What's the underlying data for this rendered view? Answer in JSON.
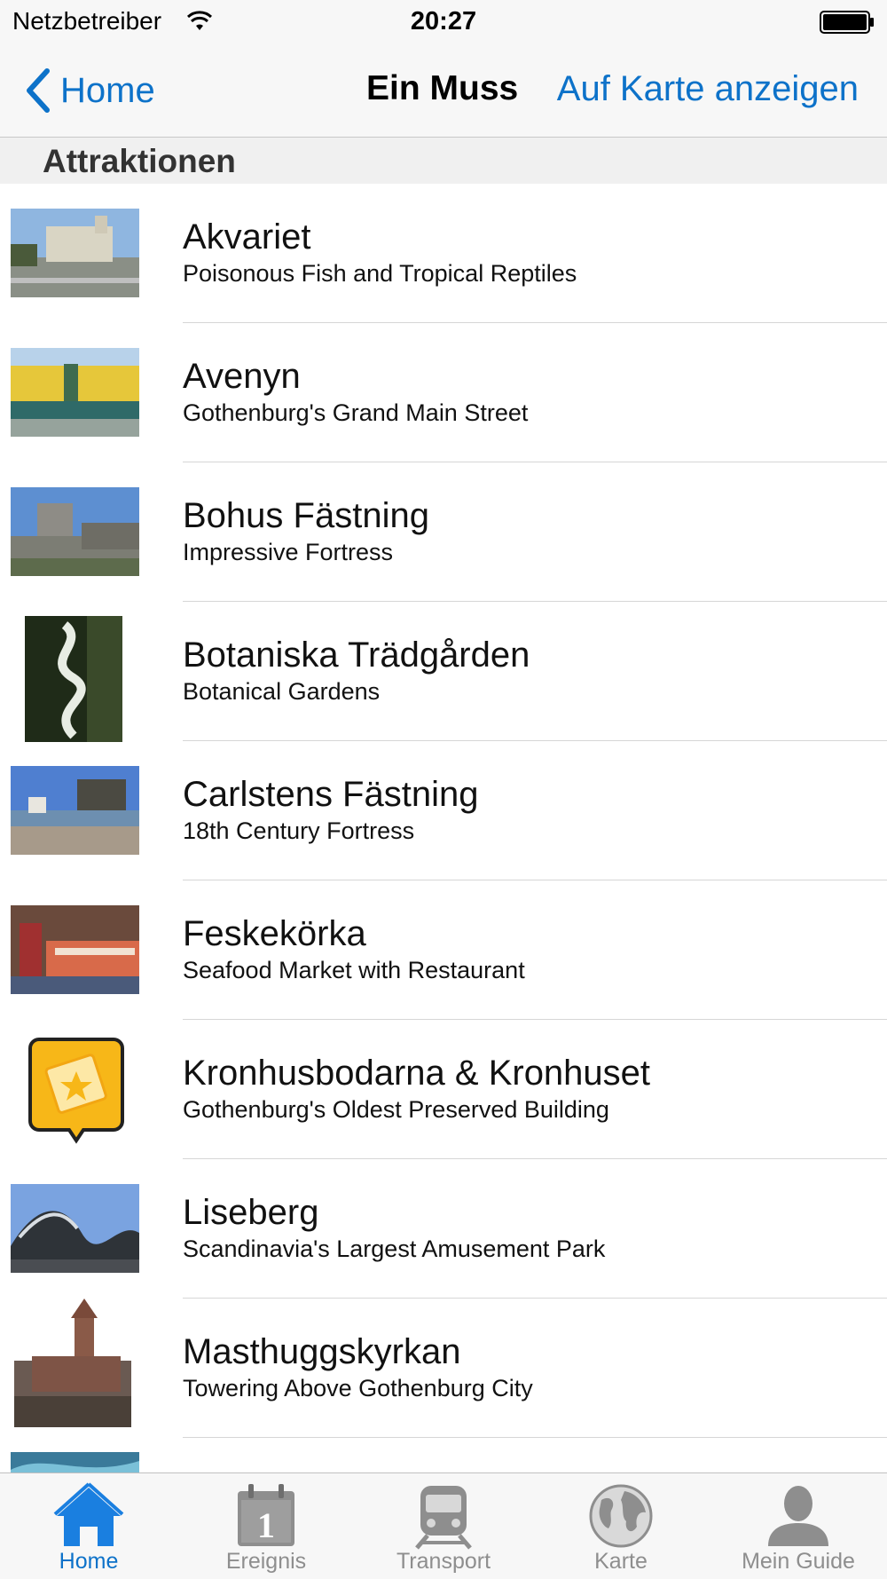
{
  "status_bar": {
    "carrier": "Netzbetreiber",
    "time": "20:27"
  },
  "nav": {
    "back_label": "Home",
    "title": "Ein Muss",
    "right_action": "Auf Karte anzeigen"
  },
  "section": {
    "title": "Attraktionen"
  },
  "items": [
    {
      "title": "Akvariet",
      "subtitle": "Poisonous Fish and Tropical Reptiles"
    },
    {
      "title": "Avenyn",
      "subtitle": "Gothenburg's Grand Main Street"
    },
    {
      "title": "Bohus Fästning",
      "subtitle": "Impressive Fortress"
    },
    {
      "title": "Botaniska Trädgården",
      "subtitle": "Botanical Gardens"
    },
    {
      "title": "Carlstens Fästning",
      "subtitle": "18th Century Fortress"
    },
    {
      "title": "Feskekörka",
      "subtitle": "Seafood Market with Restaurant"
    },
    {
      "title": "Kronhusbodarna & Kronhuset",
      "subtitle": "Gothenburg's Oldest Preserved Building"
    },
    {
      "title": "Liseberg",
      "subtitle": "Scandinavia's Largest Amusement Park"
    },
    {
      "title": "Masthuggskyrkan",
      "subtitle": "Towering Above Gothenburg City"
    }
  ],
  "tabs": [
    {
      "label": "Home",
      "icon": "home-icon",
      "active": true
    },
    {
      "label": "Ereignis",
      "icon": "calendar-icon",
      "active": false
    },
    {
      "label": "Transport",
      "icon": "train-icon",
      "active": false
    },
    {
      "label": "Karte",
      "icon": "globe-icon",
      "active": false
    },
    {
      "label": "Mein Guide",
      "icon": "person-icon",
      "active": false
    }
  ],
  "colors": {
    "accent": "#0d72c9",
    "inactive_tab": "#8e8e8e",
    "bar_background": "#f7f7f7",
    "badge_yellow": "#f7b718"
  }
}
